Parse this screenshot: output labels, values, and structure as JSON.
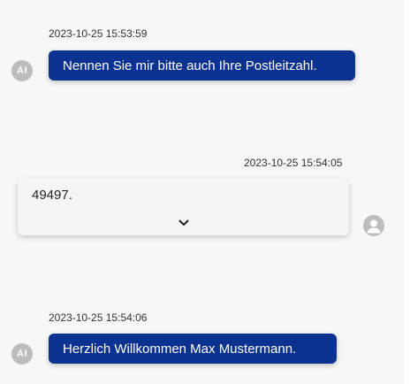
{
  "messages": [
    {
      "sender": "ai",
      "timestamp": "2023-10-25 15:53:59",
      "text": "Nennen Sie mir bitte auch Ihre Postleitzahl.",
      "avatar_label": "AI"
    },
    {
      "sender": "user",
      "timestamp": "2023-10-25 15:54:05",
      "text": "49497.",
      "expand_icon": "chevron-down-icon"
    },
    {
      "sender": "ai",
      "timestamp": "2023-10-25 15:54:06",
      "text": "Herzlich Willkommen Max Mustermann.",
      "avatar_label": "AI"
    }
  ],
  "colors": {
    "ai_bubble": "#0b3191",
    "user_bubble": "#f5f5f5",
    "avatar": "#bdbdbd",
    "background": "#f7f7f8"
  }
}
